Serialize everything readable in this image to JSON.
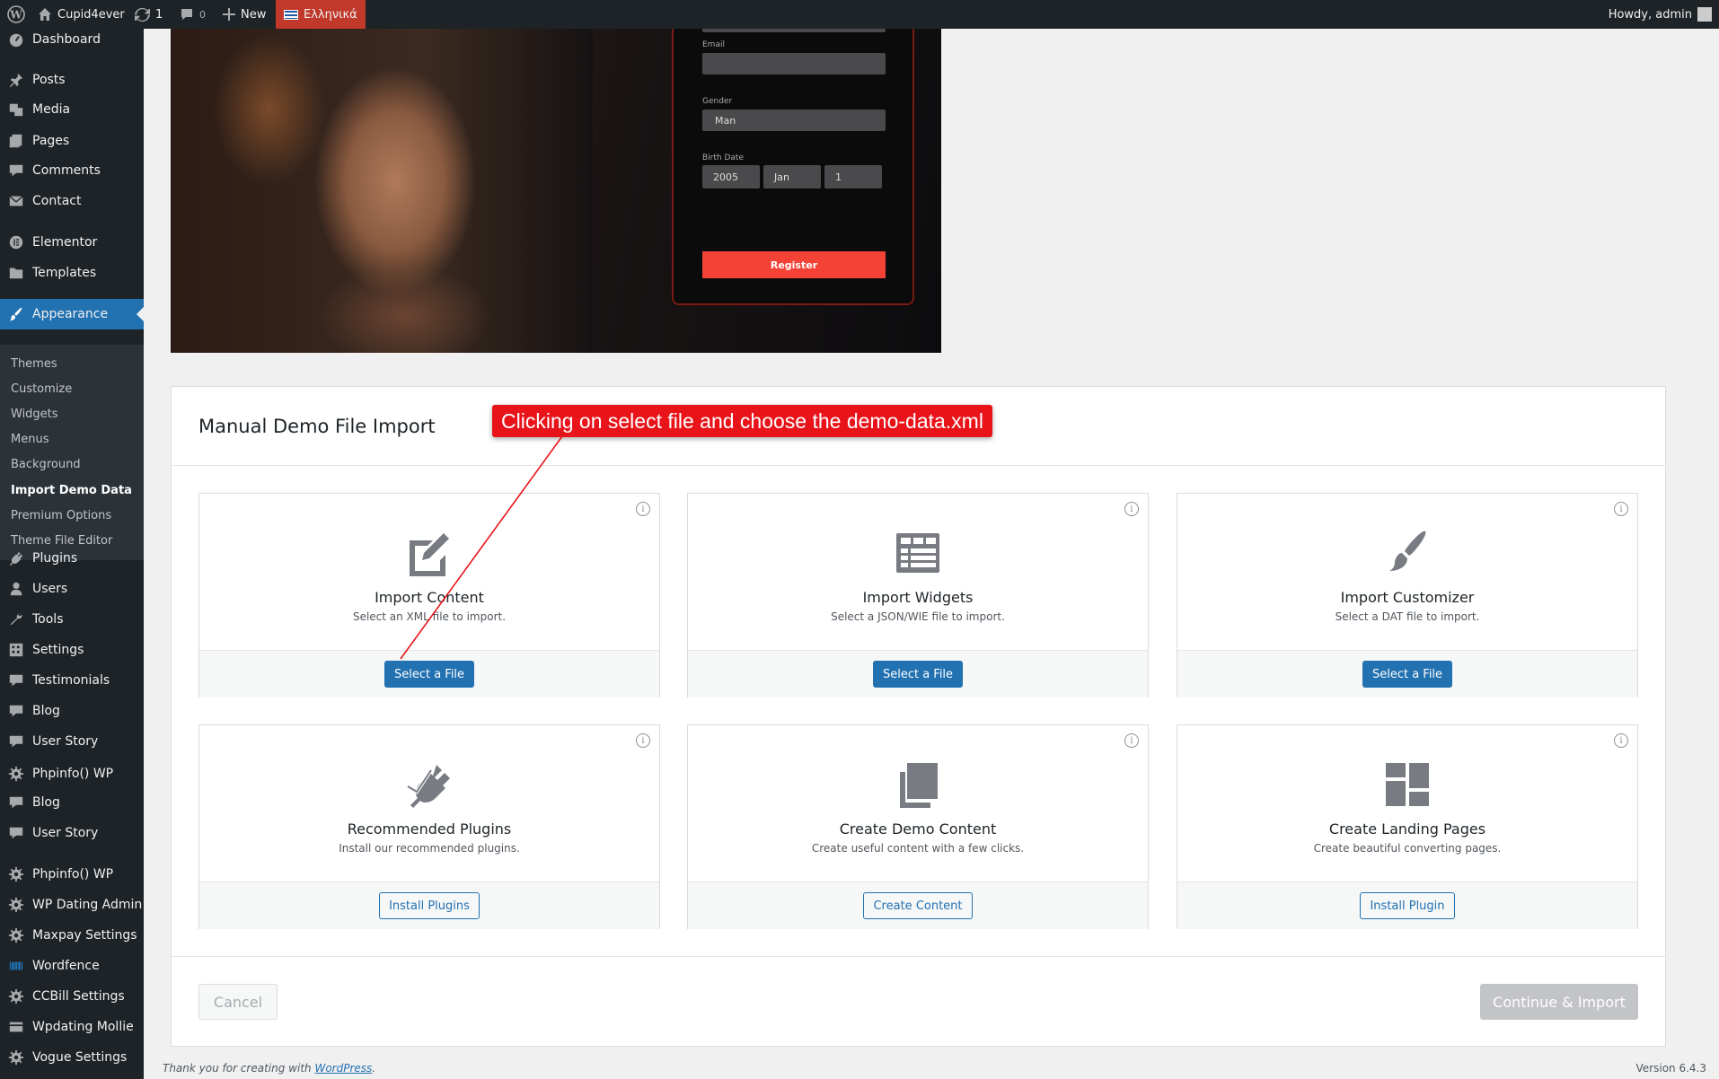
{
  "adminbar": {
    "site_name": "Cupid4ever",
    "updates_count": "1",
    "comments_count": "0",
    "new_label": "New",
    "language_label": "Ελληνικά",
    "howdy": "Howdy, admin"
  },
  "sidebar": {
    "items": [
      {
        "label": "Dashboard",
        "icon": "dashboard-icon"
      },
      {
        "label": "Posts",
        "icon": "pin-icon"
      },
      {
        "label": "Media",
        "icon": "media-icon"
      },
      {
        "label": "Pages",
        "icon": "pages-icon"
      },
      {
        "label": "Comments",
        "icon": "comment-icon"
      },
      {
        "label": "Contact",
        "icon": "mail-icon"
      },
      {
        "label": "Elementor",
        "icon": "elementor-icon"
      },
      {
        "label": "Templates",
        "icon": "folder-icon"
      },
      {
        "label": "Appearance",
        "icon": "brush-icon"
      },
      {
        "label": "Plugins",
        "icon": "plugin-icon"
      },
      {
        "label": "Users",
        "icon": "user-icon"
      },
      {
        "label": "Tools",
        "icon": "wrench-icon"
      },
      {
        "label": "Settings",
        "icon": "settings-icon"
      },
      {
        "label": "Testimonials",
        "icon": "comment-icon"
      },
      {
        "label": "Blog",
        "icon": "comment-icon"
      },
      {
        "label": "User Story",
        "icon": "comment-icon"
      },
      {
        "label": "Phpinfo() WP",
        "icon": "gear-icon"
      },
      {
        "label": "Blog",
        "icon": "comment-icon"
      },
      {
        "label": "User Story",
        "icon": "comment-icon"
      },
      {
        "label": "Phpinfo() WP",
        "icon": "gear-icon"
      },
      {
        "label": "WP Dating Admin",
        "icon": "gear-icon"
      },
      {
        "label": "Maxpay Settings",
        "icon": "gear-icon"
      },
      {
        "label": "Wordfence",
        "icon": "wordfence-icon"
      },
      {
        "label": "CCBill Settings",
        "icon": "gear-icon"
      },
      {
        "label": "Wpdating Mollie",
        "icon": "card-icon"
      },
      {
        "label": "Vogue Settings",
        "icon": "gear-icon"
      }
    ],
    "submenu": [
      "Themes",
      "Customize",
      "Widgets",
      "Menus",
      "Background",
      "Import Demo Data",
      "Premium Options",
      "Theme File Editor"
    ]
  },
  "hero": {
    "email_label": "Email",
    "gender_label": "Gender",
    "gender_value": "Man",
    "birth_label": "Birth Date",
    "year": "2005",
    "month": "Jan",
    "day": "1",
    "register_label": "Register"
  },
  "panel": {
    "title": "Manual Demo File Import",
    "annotation": "Clicking on select file and choose the demo-data.xml",
    "cards": [
      {
        "title": "Import Content",
        "desc": "Select an XML file to import.",
        "button": "Select a File",
        "icon": "edit-icon"
      },
      {
        "title": "Import Widgets",
        "desc": "Select a JSON/WIE file to import.",
        "button": "Select a File",
        "icon": "widgets-icon"
      },
      {
        "title": "Import Customizer",
        "desc": "Select a DAT file to import.",
        "button": "Select a File",
        "icon": "brush-icon"
      },
      {
        "title": "Recommended Plugins",
        "desc": "Install our recommended plugins.",
        "button": "Install Plugins",
        "icon": "plugin-icon"
      },
      {
        "title": "Create Demo Content",
        "desc": "Create useful content with a few clicks.",
        "button": "Create Content",
        "icon": "pages-icon"
      },
      {
        "title": "Create Landing Pages",
        "desc": "Create beautiful converting pages.",
        "button": "Install Plugin",
        "icon": "layout-icon"
      }
    ],
    "cancel_label": "Cancel",
    "continue_label": "Continue & Import"
  },
  "footer": {
    "thanks_prefix": "Thank you for creating with ",
    "thanks_link": "WordPress",
    "thanks_suffix": ".",
    "version": "Version 6.4.3"
  }
}
